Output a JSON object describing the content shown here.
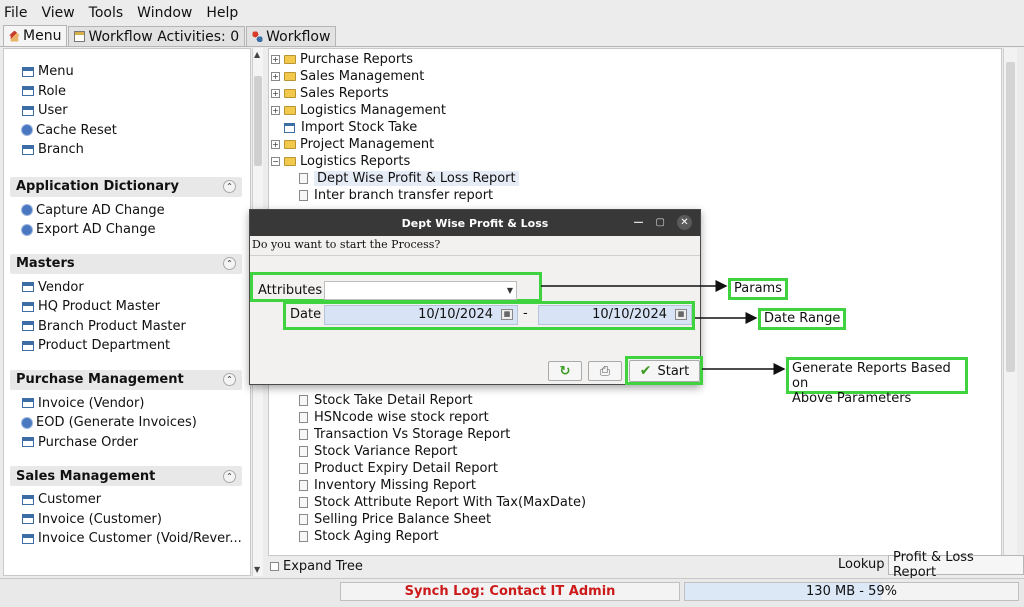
{
  "menubar": [
    "File",
    "View",
    "Tools",
    "Window",
    "Help"
  ],
  "tabs": [
    {
      "label": "Menu",
      "icon": "home-icon"
    },
    {
      "label": "Workflow Activities: 0",
      "icon": "calendar-icon"
    },
    {
      "label": "Workflow",
      "icon": "workflow-icon"
    }
  ],
  "left": {
    "top_items": [
      "Menu",
      "Role",
      "User",
      "Cache Reset",
      "Branch"
    ],
    "sections": [
      {
        "title": "Application Dictionary",
        "items": [
          "Capture AD Change",
          "Export AD Change"
        ]
      },
      {
        "title": "Masters",
        "items": [
          "Vendor",
          "HQ Product Master",
          "Branch Product Master",
          "Product Department"
        ]
      },
      {
        "title": "Purchase Management",
        "items": [
          "Invoice (Vendor)",
          "EOD (Generate Invoices)",
          "Purchase Order"
        ]
      },
      {
        "title": "Sales Management",
        "items": [
          "Customer",
          "Invoice (Customer)",
          "Invoice Customer (Void/Rever..."
        ]
      }
    ]
  },
  "tree": {
    "folders": [
      "Purchase Reports",
      "Sales Management",
      "Sales Reports",
      "Logistics Management",
      "Import Stock Take",
      "Project Management",
      "Logistics Reports"
    ],
    "reports_top": [
      "Dept Wise Profit & Loss Report",
      "Inter branch transfer report"
    ],
    "reports_bottom": [
      "Stock Take Detail Report",
      "HSNcode wise stock report",
      "Transaction Vs Storage Report",
      "Stock Variance Report",
      "Product Expiry Detail Report",
      "Inventory Missing Report",
      "Stock Attribute Report With Tax(MaxDate)",
      "Selling Price Balance Sheet",
      "Stock Aging Report"
    ],
    "expand_tree": "Expand Tree"
  },
  "bottom": {
    "lookup": "Lookup",
    "profit_btn": "Profit & Loss Report"
  },
  "status": {
    "synch": "Synch Log: Contact IT Admin",
    "memory": "130 MB - 59%",
    "memory_fraction": 0.59
  },
  "dialog": {
    "title": "Dept Wise Profit & Loss",
    "question": "Do you want to start the Process?",
    "attributes_label": "Attributes",
    "date_label": "Date",
    "date_from": "10/10/2024",
    "date_sep": "-",
    "date_to": "10/10/2024",
    "start": "Start"
  },
  "callouts": {
    "params": "Params",
    "date_range": "Date Range",
    "generate_line1": "Generate Reports Based on",
    "generate_line2": "Above Parameters"
  },
  "colors": {
    "highlight": "#3fd33f",
    "synch_text": "#cc1a1a",
    "dialog_title": "#383838"
  }
}
